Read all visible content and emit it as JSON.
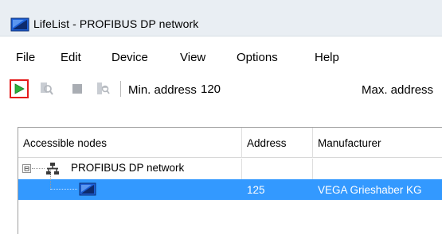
{
  "window": {
    "title": "LifeList - PROFIBUS DP network"
  },
  "menu": {
    "items": [
      {
        "label": "File"
      },
      {
        "label": "Edit"
      },
      {
        "label": "Device"
      },
      {
        "label": "View"
      },
      {
        "label": "Options"
      },
      {
        "label": "Help"
      }
    ]
  },
  "toolbar": {
    "buttons": [
      {
        "icon": "play-icon",
        "enabled": true,
        "highlighted": true
      },
      {
        "icon": "search-device-icon",
        "enabled": false
      },
      {
        "icon": "stop-icon",
        "enabled": false
      },
      {
        "icon": "search-network-icon",
        "enabled": false
      }
    ],
    "min_address_label": "Min. address",
    "min_address_value": "120",
    "max_address_label": "Max. address"
  },
  "table": {
    "columns": [
      {
        "label": "Accessible nodes"
      },
      {
        "label": "Address"
      },
      {
        "label": "Manufacturer"
      }
    ],
    "rows": [
      {
        "node": "PROFIBUS DP network",
        "address": "",
        "manufacturer": "",
        "expander": "⊟",
        "icon": "network-icon",
        "selected": false
      },
      {
        "node": "",
        "address": "125",
        "manufacturer": "VEGA Grieshaber KG",
        "icon": "device-icon",
        "selected": true
      }
    ]
  },
  "colors": {
    "highlight_border": "#e41c1c",
    "selection": "#3399ff",
    "run_green": "#2bb03a",
    "device_blue": "#1c5fd6"
  }
}
